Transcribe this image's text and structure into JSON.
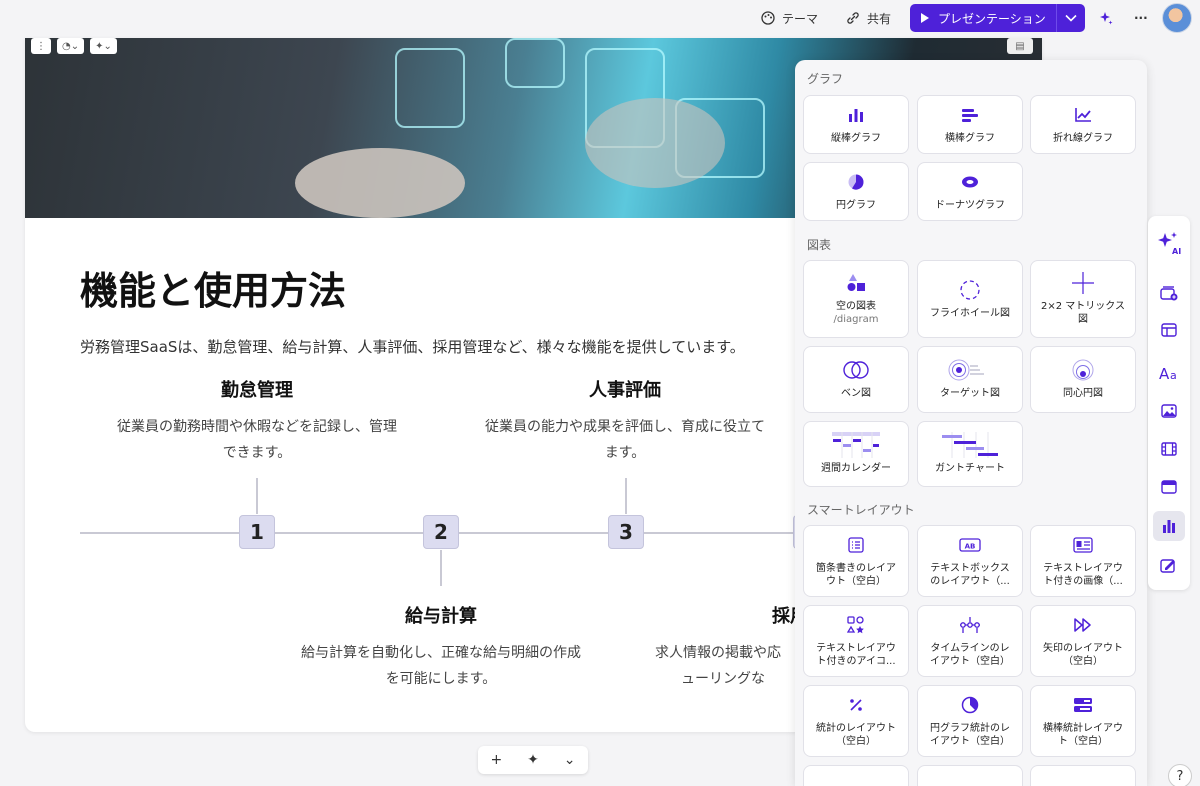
{
  "topbar": {
    "theme_label": "テーマ",
    "share_label": "共有",
    "present_label": "プレゼンテーション",
    "more_label": "···"
  },
  "slide": {
    "title": "機能と使用方法",
    "description": "労務管理SaaSは、勤怠管理、給与計算、人事評価、採用管理など、様々な機能を提供しています。",
    "items": [
      {
        "heading": "勤怠管理",
        "line1": "従業員の勤務時間や休暇などを記録し、管理",
        "line2": "できます。"
      },
      {
        "heading": "人事評価",
        "line1": "従業員の能力や成果を評価し、育成に役立て",
        "line2": "ます。"
      },
      {
        "heading": "給与計算",
        "line1": "給与計算を自動化し、正確な給与明細の作成",
        "line2": "を可能にします。"
      },
      {
        "heading": "採用",
        "line1": "求人情報の掲載や応",
        "line2": "ューリングな"
      }
    ],
    "steps": [
      "1",
      "2",
      "3"
    ]
  },
  "panel": {
    "graph_section": "グラフ",
    "graphs": [
      "縦棒グラフ",
      "横棒グラフ",
      "折れ線グラフ",
      "円グラフ",
      "ドーナツグラフ"
    ],
    "diagram_section": "図表",
    "diagrams": [
      {
        "label": "空の図表",
        "sub": "/diagram"
      },
      {
        "label": "フライホイール図",
        "sub": ""
      },
      {
        "label": "2×2 マトリックス",
        "sub": "図"
      },
      {
        "label": "ベン図",
        "sub": ""
      },
      {
        "label": "ターゲット図",
        "sub": ""
      },
      {
        "label": "同心円図",
        "sub": ""
      },
      {
        "label": "週間カレンダー",
        "sub": ""
      },
      {
        "label": "ガントチャート",
        "sub": ""
      }
    ],
    "smart_section": "スマートレイアウト",
    "smart": [
      {
        "l1": "箇条書きのレイア",
        "l2": "ウト（空白）"
      },
      {
        "l1": "テキストボックス",
        "l2": "のレイアウト（..."
      },
      {
        "l1": "テキストレイアウ",
        "l2": "ト付きの画像（..."
      },
      {
        "l1": "テキストレイアウ",
        "l2": "ト付きのアイコ..."
      },
      {
        "l1": "タイムラインのレ",
        "l2": "イアウト（空白）"
      },
      {
        "l1": "矢印のレイアウト",
        "l2": "（空白）"
      },
      {
        "l1": "統計のレイアウト",
        "l2": "（空白）"
      },
      {
        "l1": "円グラフ統計のレ",
        "l2": "イアウト（空白）"
      },
      {
        "l1": "横棒統計レイアウ",
        "l2": "ト（空白）"
      }
    ]
  },
  "rbar": {
    "ai_label": "AI"
  },
  "bottom": {
    "add": "+",
    "chevron": "⌄"
  },
  "help": "?",
  "colors": {
    "accent": "#4e21d9",
    "accent_light": "#5b3fe0"
  }
}
